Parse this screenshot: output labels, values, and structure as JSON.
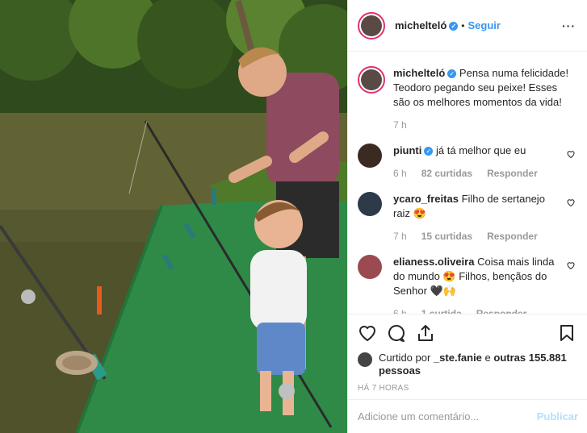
{
  "header": {
    "username": "michelteló",
    "dot": "•",
    "follow_label": "Seguir",
    "more_label": "···"
  },
  "caption": {
    "username": "michelteló",
    "text": "Pensa numa felicidade! Teodoro pegando seu peixe! Esses são os melhores momentos da vida!",
    "time": "7 h"
  },
  "comments": [
    {
      "username": "piunti",
      "verified": true,
      "text": "já tá melhor que eu",
      "time": "6 h",
      "likes": "82 curtidas",
      "reply": "Responder"
    },
    {
      "username": "ycaro_freitas",
      "verified": false,
      "text": "Filho de sertanejo raiz 😍",
      "time": "7 h",
      "likes": "15 curtidas",
      "reply": "Responder"
    },
    {
      "username": "elianess.oliveira",
      "verified": false,
      "text": "Coisa mais linda do mundo 😍 Filhos, bençãos do Senhor 🖤🙌",
      "time": "6 h",
      "likes": "1 curtida",
      "reply": "Responder"
    }
  ],
  "likes": {
    "prefix": "Curtido por",
    "user": "_ste.fanie",
    "middle": "e",
    "others": "outras 155.881 pessoas"
  },
  "timestamp": "HÁ 7 HORAS",
  "add_comment": {
    "placeholder": "Adicione um comentário...",
    "publish_label": "Publicar"
  },
  "colors": {
    "accent": "#3897f0",
    "publish_disabled": "#b2dffc",
    "muted": "#999999"
  }
}
